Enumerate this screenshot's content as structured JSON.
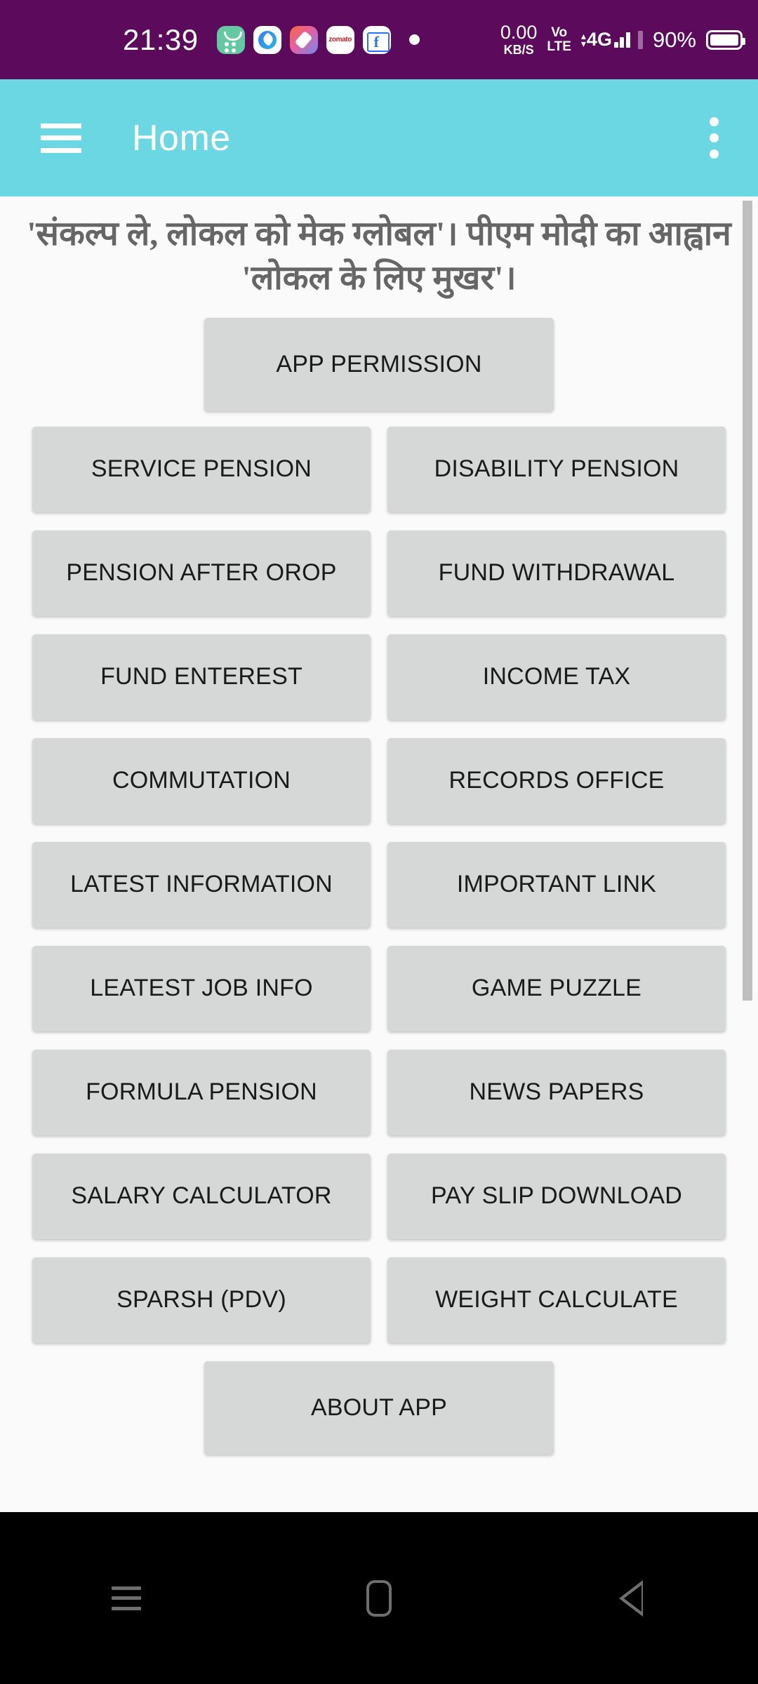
{
  "status_bar": {
    "time": "21:39",
    "background_color": "#5C0B5C",
    "notification_icons": [
      {
        "name": "green-grid-app-icon",
        "label": ""
      },
      {
        "name": "blue-browser-app-icon",
        "label": ""
      },
      {
        "name": "gradient-paint-app-icon",
        "label": ""
      },
      {
        "name": "zomato-app-icon",
        "label": "zomato"
      },
      {
        "name": "flipkart-app-icon",
        "label": "f"
      }
    ],
    "network_speed_value": "0.00",
    "network_speed_unit": "KB/S",
    "volte_line1": "Vo",
    "volte_line2": "LTE",
    "network_type": "4G",
    "battery_percent": "90%"
  },
  "appbar": {
    "title": "Home",
    "background_color": "#6BD7E3",
    "menu_icon": "hamburger-icon",
    "overflow_icon": "kebab-menu-icon"
  },
  "banner": {
    "text": "'संकल्प ले, लोकल को मेक ग्लोबल'। पीएम मोदी का आह्वान 'लोकल के लिए मुखर'।"
  },
  "main": {
    "top_button": "APP PERMISSION",
    "bottom_button": "ABOUT APP",
    "button_color": "#D6D7D7",
    "grid_rows": [
      [
        "SERVICE PENSION",
        "DISABILITY PENSION"
      ],
      [
        "PENSION AFTER OROP",
        "FUND WITHDRAWAL"
      ],
      [
        "FUND ENTEREST",
        "INCOME TAX"
      ],
      [
        "COMMUTATION",
        "RECORDS OFFICE"
      ],
      [
        "LATEST INFORMATION",
        "IMPORTANT LINK"
      ],
      [
        "LEATEST JOB INFO",
        "GAME PUZZLE"
      ],
      [
        "FORMULA PENSION",
        "NEWS PAPERS"
      ],
      [
        "SALARY CALCULATOR",
        "PAY SLIP DOWNLOAD"
      ],
      [
        "SPARSH (PDV)",
        "WEIGHT CALCULATE"
      ]
    ]
  },
  "navbar": {
    "recents_icon": "recents-icon",
    "home_icon": "home-icon",
    "back_icon": "back-icon"
  }
}
